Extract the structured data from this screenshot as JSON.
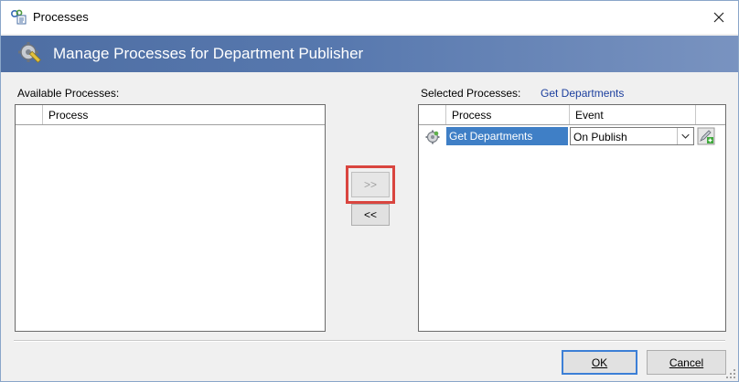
{
  "window": {
    "title": "Processes",
    "banner_title": "Manage Processes for Department Publisher"
  },
  "available": {
    "label": "Available Processes:",
    "columns": [
      "Process"
    ],
    "rows": []
  },
  "selected": {
    "label": "Selected Processes:",
    "current": "Get Departments",
    "columns": [
      "Process",
      "Event"
    ],
    "rows": [
      {
        "process": "Get Departments",
        "event": "On Publish"
      }
    ]
  },
  "transfer": {
    "add_label": ">>",
    "remove_label": "<<"
  },
  "footer": {
    "ok_label": "OK",
    "cancel_label": "Cancel"
  },
  "colors": {
    "banner": "#5778ae",
    "selection": "#3f7fc6",
    "highlight_box": "#d9453f",
    "link": "#1c3f9e"
  }
}
